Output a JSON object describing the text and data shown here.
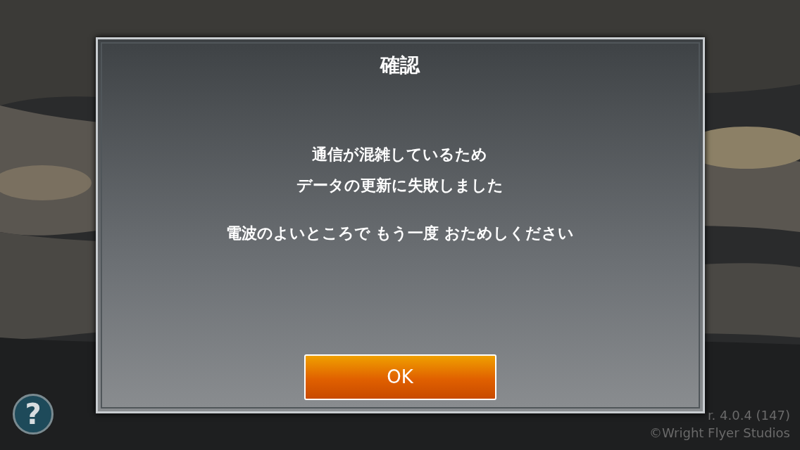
{
  "dialog": {
    "title": "確認",
    "paragraphs": [
      [
        "通信が混雑しているため",
        "データの更新に失敗しました"
      ],
      [
        "電波のよいところで もう一度 おためしください"
      ]
    ],
    "ok_button": "OK"
  },
  "footer": {
    "version": "r. 4.0.4 (147)",
    "copyright": "©Wright Flyer Studios",
    "help_glyph": "?"
  }
}
